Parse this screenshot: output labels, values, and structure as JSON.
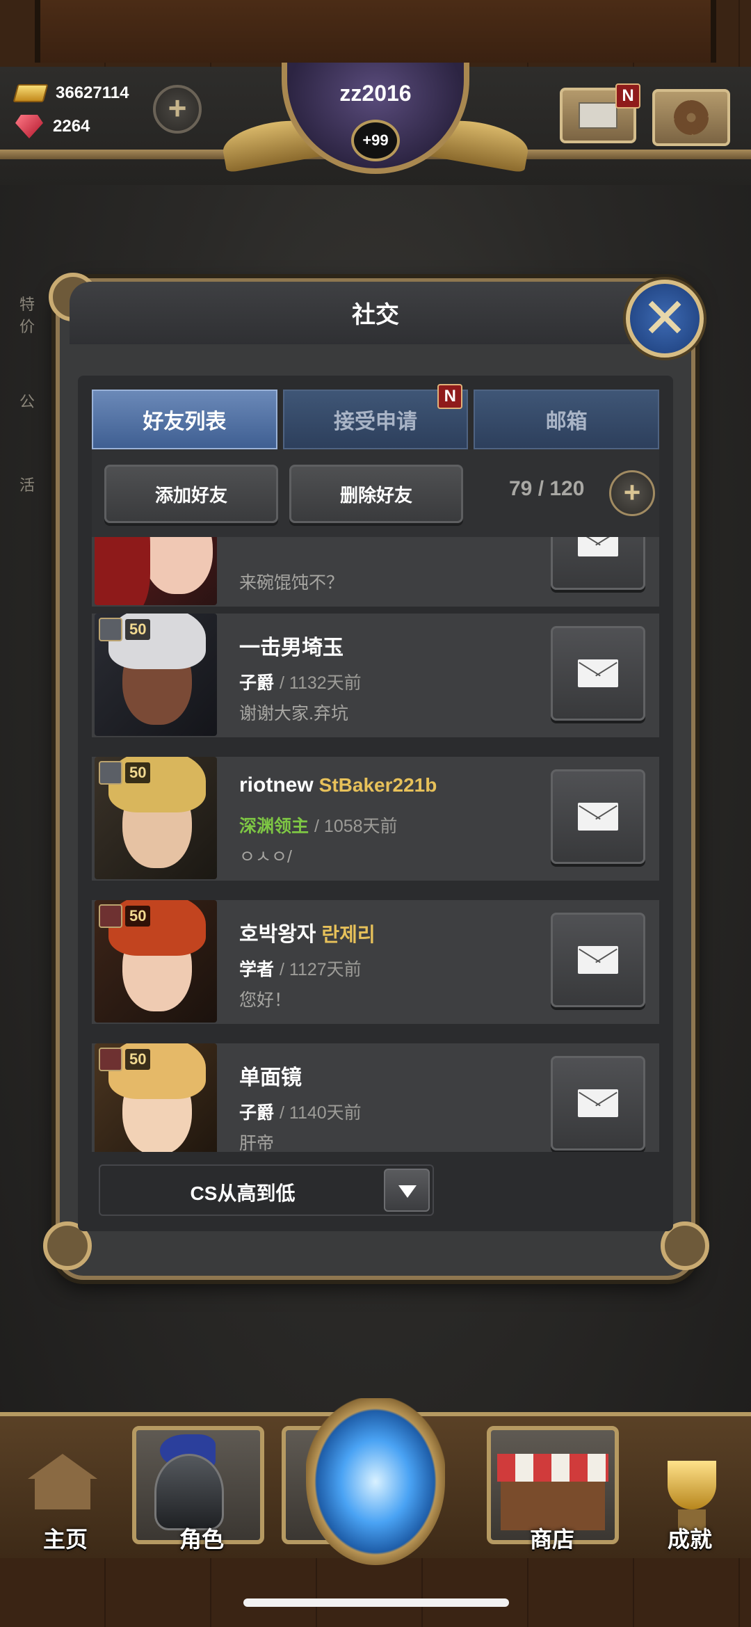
{
  "header": {
    "gold": "36627114",
    "gems": "2264",
    "player_name": "zz2016",
    "level_badge": "+99",
    "mail_badge": "N"
  },
  "side_menu": [
    "特价",
    "公",
    "活"
  ],
  "panel": {
    "title": "社交",
    "tabs": [
      {
        "label": "好友列表",
        "active": true
      },
      {
        "label": "接受申请",
        "active": false,
        "badge": "N"
      },
      {
        "label": "邮箱",
        "active": false
      }
    ],
    "add_friend": "添加好友",
    "remove_friend": "删除好友",
    "friend_count": "79 / 120",
    "sort_label": "CS从高到低"
  },
  "friends": [
    {
      "name": "",
      "guild": "",
      "rank": "",
      "last_login": "",
      "message": "来碗馄饨不？",
      "level": "",
      "class_icon": "",
      "partial": true
    },
    {
      "name": "一击男埼玉",
      "guild": "",
      "rank": "子爵",
      "last_login": "1132天前",
      "message": "谢谢大家.弃坑",
      "level": "50",
      "class_icon": "shield"
    },
    {
      "name": "riotnew",
      "guild": "StBaker221b",
      "rank": "深渊领主",
      "rank_color": "#7ec744",
      "last_login": "1058天前",
      "message": "ㅇㅅㅇ/",
      "level": "50",
      "class_icon": "shield"
    },
    {
      "name": "호박왕자",
      "guild": "란제리",
      "rank": "学者",
      "last_login": "1127天前",
      "message": "您好！",
      "level": "50",
      "class_icon": "sword"
    },
    {
      "name": "单面镜",
      "guild": "",
      "rank": "子爵",
      "last_login": "1140天前",
      "message": "肝帝",
      "level": "50",
      "class_icon": "sword"
    }
  ],
  "bottom_nav": {
    "home": "主页",
    "character": "角色",
    "shop": "商店",
    "achievements": "成就"
  },
  "colors": {
    "accent_gold": "#e7c15a",
    "tab_active": "#6b89b8",
    "badge_red": "#8f1b1b"
  }
}
